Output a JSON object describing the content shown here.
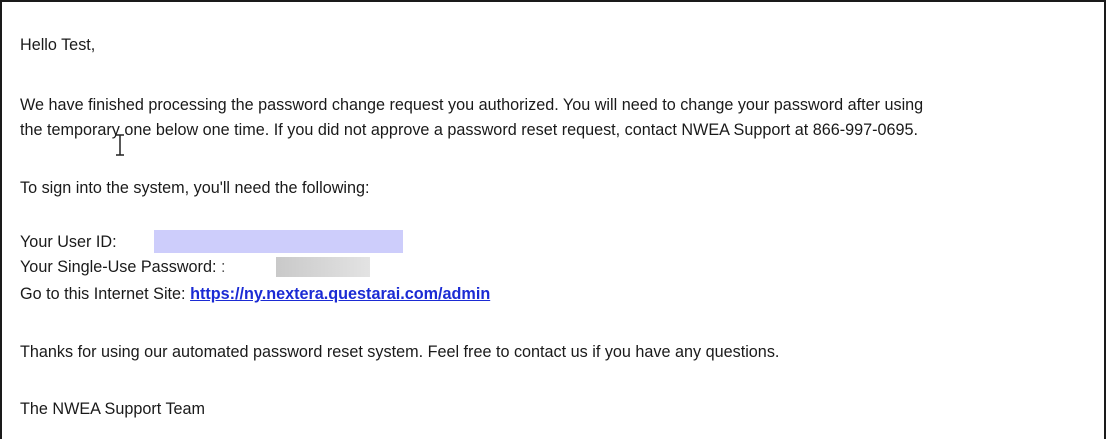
{
  "email": {
    "greeting": "Hello Test,",
    "paragraph1_line1": "We have finished processing the password change request you authorized. You will need to change your password after using",
    "paragraph1_line2": "the temporary one below one time. If you did not approve a password reset request, contact NWEA Support at 866-997-0695.",
    "instructions": "To sign into the system, you'll need the following:",
    "user_id_label": "Your User ID:",
    "password_label": "Your Single-Use Password:",
    "password_colon": ":",
    "site_label": "Go to this Internet Site:",
    "site_link": "https://ny.nextera.questarai.com/admin",
    "thanks": "Thanks for using our automated password reset system. Feel free to contact us if you have any questions.",
    "signature": "The NWEA Support Team"
  },
  "colors": {
    "link": "#1b2bd4",
    "userid_redaction": "#cdcdfb",
    "password_redaction": "#d6d6d6",
    "text": "#1a1a1a"
  },
  "cursor": {
    "icon": "text-ibeam-cursor-icon"
  }
}
